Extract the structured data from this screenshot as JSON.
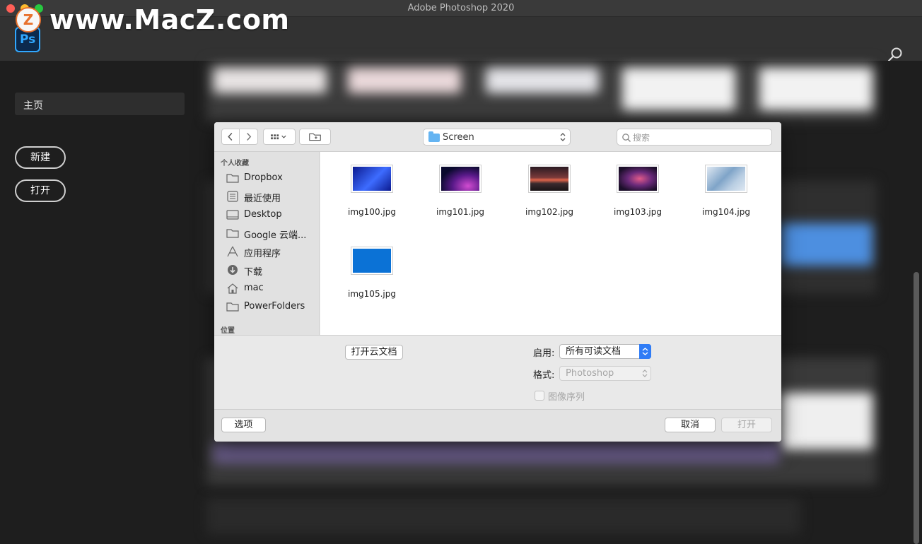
{
  "window": {
    "title": "Adobe Photoshop 2020"
  },
  "watermark": {
    "badge": "Z",
    "text": "www.MacZ.com"
  },
  "app": {
    "logo_text": "Ps"
  },
  "sidebar": {
    "home_label": "主页",
    "new_label": "新建",
    "open_label": "打开"
  },
  "dialog": {
    "location": "Screen",
    "search_placeholder": "搜索",
    "favorites_header": "个人收藏",
    "locations_header": "位置",
    "favorites": [
      {
        "label": "Dropbox",
        "icon": "folder-icon"
      },
      {
        "label": "最近使用",
        "icon": "recents-icon"
      },
      {
        "label": "Desktop",
        "icon": "desktop-icon"
      },
      {
        "label": "Google 云端...",
        "icon": "folder-icon"
      },
      {
        "label": "应用程序",
        "icon": "applications-icon"
      },
      {
        "label": "下载",
        "icon": "download-icon"
      },
      {
        "label": "mac",
        "icon": "home-icon"
      },
      {
        "label": "PowerFolders",
        "icon": "folder-icon"
      }
    ],
    "files": [
      {
        "name": "img100.jpg",
        "colors": [
          "#0b1a8f",
          "#3d6cff"
        ]
      },
      {
        "name": "img101.jpg",
        "colors": [
          "#0a0a2e",
          "#d14cd0"
        ]
      },
      {
        "name": "img102.jpg",
        "colors": [
          "#2a1a22",
          "#e0644a"
        ]
      },
      {
        "name": "img103.jpg",
        "colors": [
          "#1c0f2a",
          "#e05a8a"
        ]
      },
      {
        "name": "img104.jpg",
        "colors": [
          "#7fa4c8",
          "#dfe8f2"
        ]
      },
      {
        "name": "img105.jpg",
        "colors": [
          "#0b72d6",
          "#0b72d6"
        ]
      }
    ],
    "open_cloud_label": "打开云文档",
    "enable_label": "启用:",
    "enable_value": "所有可读文档",
    "format_label": "格式:",
    "format_value": "Photoshop",
    "sequence_label": "图像序列",
    "options_label": "选项",
    "cancel_label": "取消",
    "open_label": "打开"
  }
}
